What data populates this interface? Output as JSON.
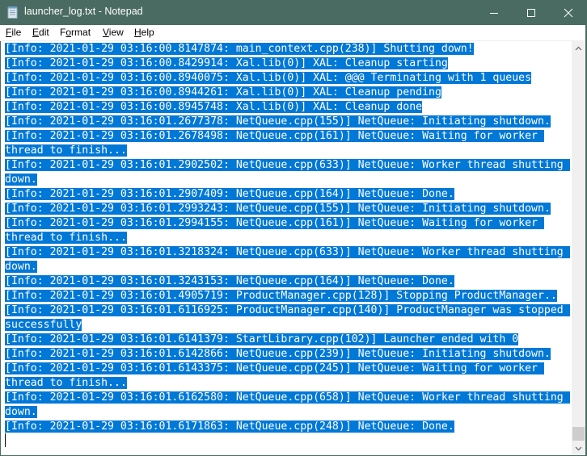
{
  "window": {
    "title": "launcher_log.txt - Notepad",
    "controls": {
      "minimize": "minimize",
      "maximize": "maximize",
      "close": "close"
    },
    "colors": {
      "titlebar": "#4a6b61",
      "selection": "#0078d7"
    }
  },
  "menu": {
    "items": [
      {
        "mnemonic": "F",
        "rest": "ile"
      },
      {
        "mnemonic": "E",
        "rest": "dit"
      },
      {
        "pre": "F",
        "mnemonic": "o",
        "rest": "rmat"
      },
      {
        "mnemonic": "V",
        "rest": "iew"
      },
      {
        "mnemonic": "H",
        "rest": "elp"
      }
    ]
  },
  "editor": {
    "lines": [
      "[Info: 2021-01-29 03:16:00.8147874: main_context.cpp(238)] Shutting down!",
      "[Info: 2021-01-29 03:16:00.8429914: Xal.lib(0)] XAL: Cleanup starting",
      "[Info: 2021-01-29 03:16:00.8940075: Xal.lib(0)] XAL: @@@ Terminating with 1 queues",
      "[Info: 2021-01-29 03:16:00.8944261: Xal.lib(0)] XAL: Cleanup pending",
      "[Info: 2021-01-29 03:16:00.8945748: Xal.lib(0)] XAL: Cleanup done",
      "[Info: 2021-01-29 03:16:01.2677378: NetQueue.cpp(155)] NetQueue: Initiating shutdown.",
      "[Info: 2021-01-29 03:16:01.2678498: NetQueue.cpp(161)] NetQueue: Waiting for worker ",
      "thread to finish...",
      "[Info: 2021-01-29 03:16:01.2902502: NetQueue.cpp(633)] NetQueue: Worker thread shutting ",
      "down.",
      "[Info: 2021-01-29 03:16:01.2907409: NetQueue.cpp(164)] NetQueue: Done.",
      "[Info: 2021-01-29 03:16:01.2993243: NetQueue.cpp(155)] NetQueue: Initiating shutdown.",
      "[Info: 2021-01-29 03:16:01.2994155: NetQueue.cpp(161)] NetQueue: Waiting for worker ",
      "thread to finish...",
      "[Info: 2021-01-29 03:16:01.3218324: NetQueue.cpp(633)] NetQueue: Worker thread shutting ",
      "down.",
      "[Info: 2021-01-29 03:16:01.3243153: NetQueue.cpp(164)] NetQueue: Done.",
      "[Info: 2021-01-29 03:16:01.4905719: ProductManager.cpp(128)] Stopping ProductManager..",
      "[Info: 2021-01-29 03:16:01.6116925: ProductManager.cpp(140)] ProductManager was stopped ",
      "successfully",
      "[Info: 2021-01-29 03:16:01.6141379: StartLibrary.cpp(102)] Launcher ended with 0",
      "[Info: 2021-01-29 03:16:01.6142866: NetQueue.cpp(239)] NetQueue: Initiating shutdown.",
      "[Info: 2021-01-29 03:16:01.6143375: NetQueue.cpp(245)] NetQueue: Waiting for worker ",
      "thread to finish...",
      "[Info: 2021-01-29 03:16:01.6162580: NetQueue.cpp(658)] NetQueue: Worker thread shutting ",
      "down.",
      "[Info: 2021-01-29 03:16:01.6171863: NetQueue.cpp(248)] NetQueue: Done.",
      ""
    ],
    "selected": true
  },
  "scrollbar": {
    "position_fraction": 1.0
  }
}
